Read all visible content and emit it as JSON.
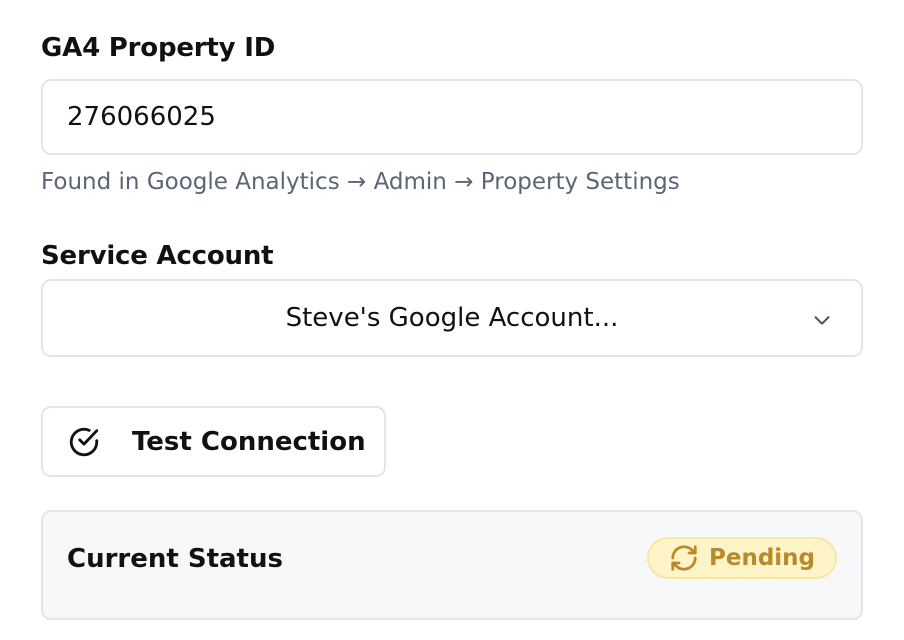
{
  "ga4": {
    "label": "GA4 Property ID",
    "value": "276066025",
    "help": "Found in Google Analytics → Admin → Property Settings"
  },
  "service_account": {
    "label": "Service Account",
    "selected": "Steve's Google Account...",
    "icon": "chevron-down-icon"
  },
  "test_button": {
    "label": "Test Connection",
    "icon": "check-circle-icon"
  },
  "status": {
    "title": "Current Status",
    "badge_label": "Pending",
    "badge_icon": "refresh-icon",
    "badge_color": "#b9892a",
    "badge_bg": "#fdf4c8"
  }
}
